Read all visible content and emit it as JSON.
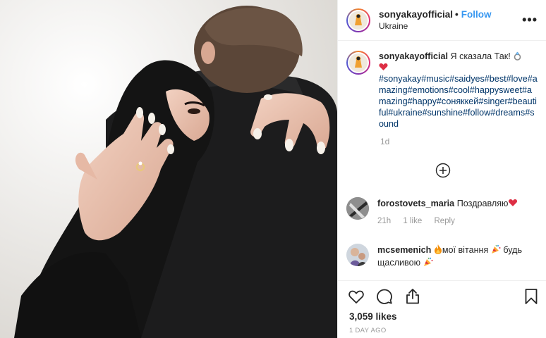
{
  "post": {
    "username": "sonyakayofficial",
    "separator": "•",
    "follow_label": "Follow",
    "location": "Ukraine",
    "more_label": "•••"
  },
  "caption": {
    "username": "sonyakayofficial",
    "text": "Я сказала Так!",
    "hashtags": "#sonyakay#music#saidyes#best#love#amazing#emotions#cool#happysweet#amazing#happy#соняккей#singer#beautiful#ukraine#sunshine#follow#dreams#sound",
    "time": "1d"
  },
  "comments": [
    {
      "username": "forostovets_maria",
      "text": "Поздравляю",
      "time": "21h",
      "likes": "1 like",
      "reply": "Reply"
    },
    {
      "username": "mcsemenich",
      "text_a": "мої вітання",
      "text_b": "будь щасливою"
    }
  ],
  "footer": {
    "likes": "3,059 likes",
    "posted": "1 DAY AGO"
  },
  "icons": [
    "heart-icon",
    "comment-icon",
    "share-icon",
    "bookmark-icon",
    "add-circle-icon",
    "ring-emoji",
    "red-heart-emoji",
    "fire-emoji",
    "party-popper-emoji"
  ],
  "colors": {
    "link": "#3897f0",
    "hashtag": "#003569",
    "muted": "#999999",
    "heart": "#ed4956"
  }
}
